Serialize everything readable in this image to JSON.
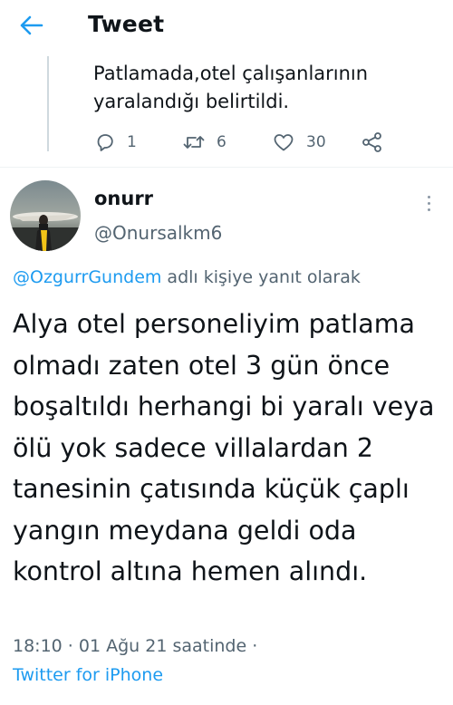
{
  "header": {
    "title": "Tweet",
    "back_icon": "arrow-left-icon",
    "accent": "#1d9bf0"
  },
  "parent_tweet": {
    "text": "Patlamada,otel çalışanlarının yaralandığı belirtildi.",
    "actions": {
      "replies": "1",
      "retweets": "6",
      "likes": "30",
      "reply_icon": "reply-icon",
      "retweet_icon": "retweet-icon",
      "like_icon": "heart-icon",
      "share_icon": "share-icon"
    }
  },
  "tweet": {
    "display_name": "onurr",
    "handle": "@Onursalkm6",
    "reply_to_mention": "@OzgurrGundem",
    "reply_to_suffix": " adlı kişiye yanıt olarak",
    "body": "Alya otel personeliyim patlama olmadı zaten otel 3 gün önce boşaltıldı herhangi bi yaralı veya ölü yok sadece villalardan 2 tanesinin çatısında küçük çaplı yangın meydana geldi oda kontrol altına hemen alındı.",
    "timestamp": "18:10 · 01 Ağu 21 saatinde ·",
    "source": "Twitter for iPhone"
  }
}
